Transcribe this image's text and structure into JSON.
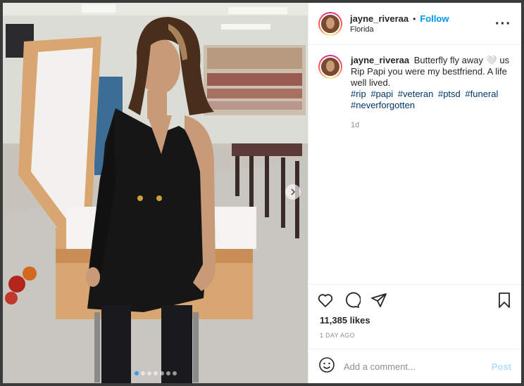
{
  "post": {
    "username": "jayne_riveraa",
    "separator": "•",
    "follow_label": "Follow",
    "location": "Florida",
    "more_icon": "more-horizontal-icon",
    "caption_username": "jayne_riveraa",
    "caption": "Butterfly fly away 🤍 us Rip Papi you were my bestfriend. A life well lived.",
    "hashtags": [
      "#rip",
      "#papi",
      "#veteran",
      "#ptsd",
      "#funeral",
      "#neverforgotten"
    ],
    "comment_time": "1d",
    "likes": "11,385 likes",
    "posted": "1 DAY AGO",
    "comment_placeholder": "Add a comment...",
    "post_label": "Post",
    "carousel": {
      "count": 7,
      "active_index": 0
    }
  },
  "icons": {
    "like": "heart-icon",
    "comment": "comment-bubble-icon",
    "share": "paper-plane-icon",
    "save": "bookmark-icon",
    "emoji": "smiley-icon",
    "next": "chevron-right-icon"
  },
  "colors": {
    "link_blue": "#0095f6",
    "hashtag": "#00376b",
    "muted": "#8e8e8e",
    "post_disabled": "#b2dffc"
  }
}
